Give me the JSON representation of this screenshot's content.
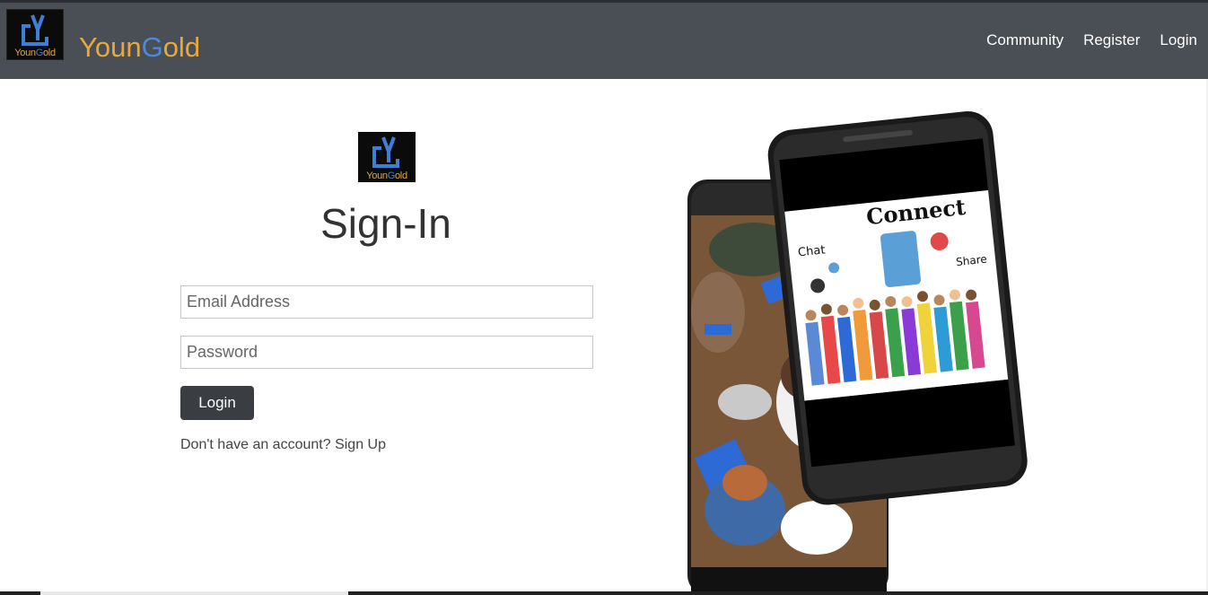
{
  "navbar": {
    "logo_text": "YounGold",
    "brand": {
      "part1": "Youn",
      "part2": "G",
      "part3": "old"
    },
    "links": [
      {
        "label": "Community"
      },
      {
        "label": "Register"
      },
      {
        "label": "Login"
      }
    ]
  },
  "signin": {
    "logo_text": "YounGold",
    "title": "Sign-In",
    "email_placeholder": "Email Address",
    "password_placeholder": "Password",
    "login_label": "Login",
    "signup_prefix": "Don't have an account? ",
    "signup_link": "Sign Up"
  },
  "hero": {
    "connect_text": "Connect",
    "chat_text": "Chat",
    "share_text": "Share"
  },
  "colors": {
    "navbar": "#4a4e55",
    "brand_gold": "#e8a93a",
    "brand_blue": "#4a8ad6",
    "button": "#3a3d41"
  }
}
